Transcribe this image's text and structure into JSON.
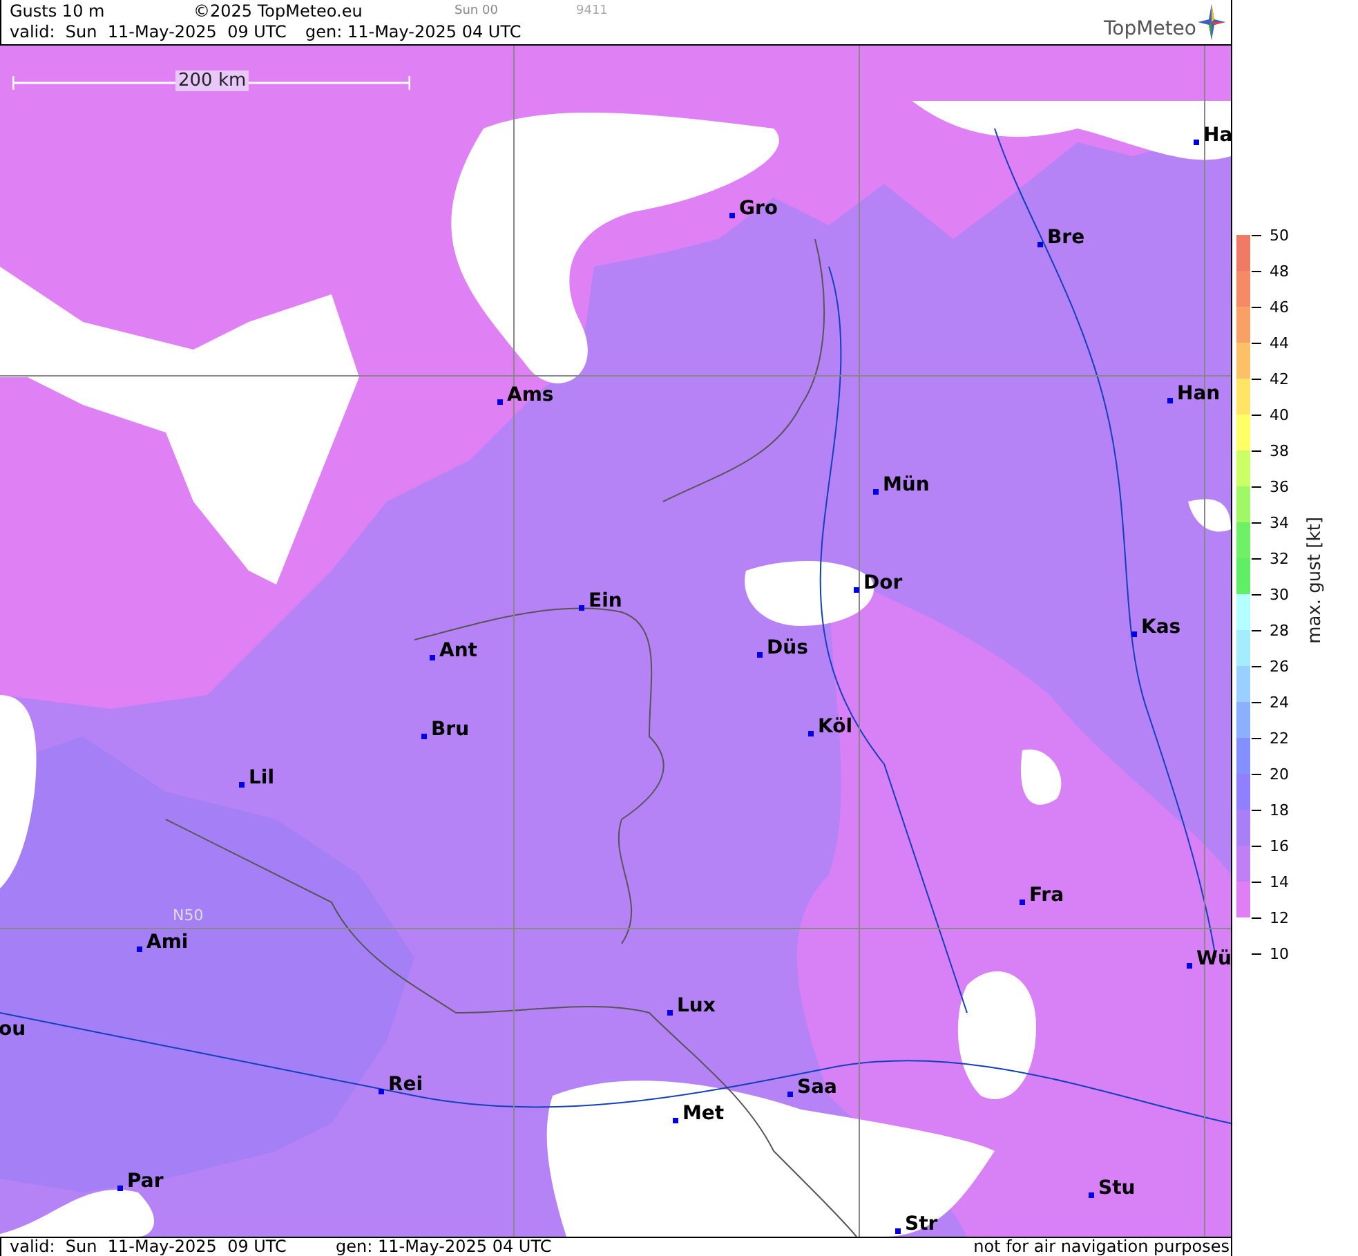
{
  "header": {
    "title": "Gusts 10 m",
    "copyright": "©2025 TopMeteo.eu",
    "run": "Sun 00",
    "code": "9411",
    "valid": "valid:  Sun  11-May-2025  09 UTC",
    "generated": "gen: 11-May-2025 04 UTC",
    "logo": "TopMeteo"
  },
  "map": {
    "scale": "200 km",
    "grid_label": "N50",
    "cities": [
      {
        "name": "Ha"
      },
      {
        "name": "Gro"
      },
      {
        "name": "Bre"
      },
      {
        "name": "Ams"
      },
      {
        "name": "Han"
      },
      {
        "name": "Mün"
      },
      {
        "name": "Dor"
      },
      {
        "name": "Ein"
      },
      {
        "name": "Kas"
      },
      {
        "name": "Düs"
      },
      {
        "name": "Ant"
      },
      {
        "name": "Köl"
      },
      {
        "name": "Bru"
      },
      {
        "name": "Lil"
      },
      {
        "name": "Fra"
      },
      {
        "name": "Ami"
      },
      {
        "name": "Wü"
      },
      {
        "name": "ou"
      },
      {
        "name": "Lux"
      },
      {
        "name": "Rei"
      },
      {
        "name": "Saa"
      },
      {
        "name": "Met"
      },
      {
        "name": "Par"
      },
      {
        "name": "Stu"
      },
      {
        "name": "Str"
      }
    ]
  },
  "legend": {
    "title": "max. gust [kt]",
    "ticks": [
      "50",
      "48",
      "46",
      "44",
      "42",
      "40",
      "38",
      "36",
      "34",
      "32",
      "30",
      "28",
      "26",
      "24",
      "22",
      "20",
      "18",
      "16",
      "14",
      "12",
      "10"
    ],
    "bands": [
      {
        "color": "#f07a66"
      },
      {
        "color": "#f58a66"
      },
      {
        "color": "#f8a066"
      },
      {
        "color": "#fcc066"
      },
      {
        "color": "#ffe466"
      },
      {
        "color": "#ffff66"
      },
      {
        "color": "#ccff66"
      },
      {
        "color": "#a0f866"
      },
      {
        "color": "#70f066"
      },
      {
        "color": "#60ee66"
      },
      {
        "color": "#b4ffff"
      },
      {
        "color": "#a6ecff"
      },
      {
        "color": "#9ad0ff"
      },
      {
        "color": "#8cb0ff"
      },
      {
        "color": "#8490ff"
      },
      {
        "color": "#9080ff"
      },
      {
        "color": "#a97ff8"
      },
      {
        "color": "#c07ff5"
      },
      {
        "color": "#e07ff5"
      }
    ]
  },
  "footer": {
    "valid": "valid:  Sun  11-May-2025  09 UTC",
    "generated": "gen: 11-May-2025 04 UTC",
    "disclaimer": "not for air navigation purposes"
  }
}
